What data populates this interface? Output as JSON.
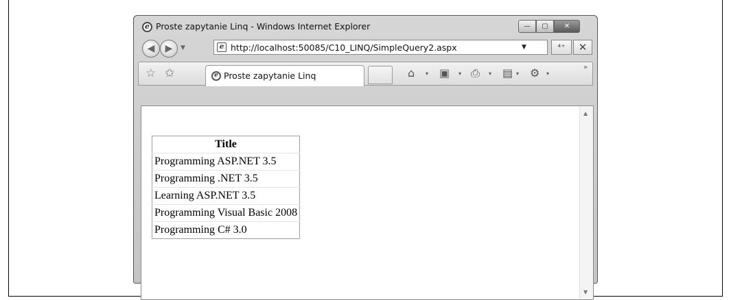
{
  "window": {
    "title": "Proste zapytanie Linq - Windows Internet Explorer",
    "controls": {
      "minimize": "—",
      "maximize": "▢",
      "close": "✕"
    }
  },
  "nav": {
    "url": "http://localhost:50085/C10_LINQ/SimpleQuery2.aspx",
    "back_glyph": "◀",
    "forward_glyph": "▶",
    "dropdown_glyph": "▼",
    "refresh_glyph": "⁴⁺",
    "stop_glyph": "✕"
  },
  "tabs": [
    {
      "label": "Proste zapytanie Linq",
      "active": true
    }
  ],
  "toolbar": {
    "favorites_glyph": "☆",
    "add_favorites_glyph": "✩",
    "home_glyph": "⌂",
    "feeds_glyph": "▣",
    "print_glyph": "⎙",
    "page_glyph": "▤",
    "tools_glyph": "⚙",
    "dropdown_glyph": "▾",
    "more_glyph": "»"
  },
  "grid": {
    "header": "Title",
    "rows": [
      "Programming ASP.NET 3.5",
      "Programming .NET 3.5",
      "Learning ASP.NET 3.5",
      "Programming Visual Basic 2008",
      "Programming C# 3.0"
    ]
  },
  "scrollbar": {
    "up_glyph": "▲",
    "down_glyph": "▼"
  },
  "icons": {
    "ie_logo": "ie-logo-icon",
    "page_icon": "page-icon"
  }
}
